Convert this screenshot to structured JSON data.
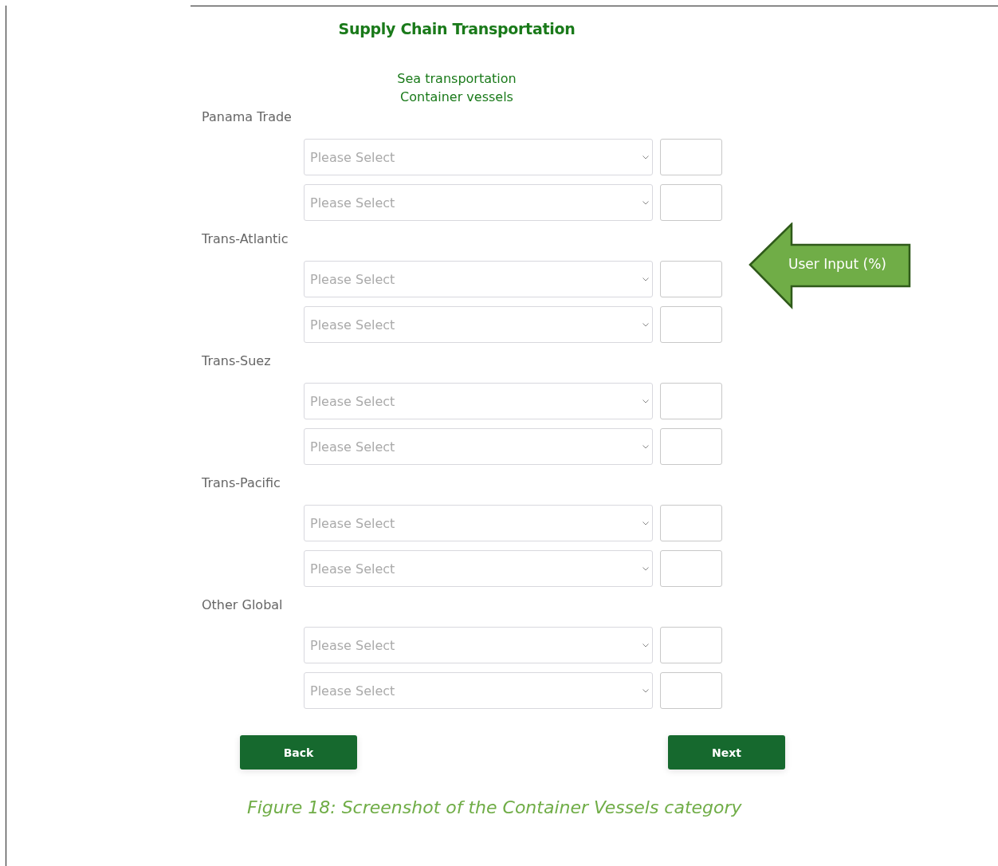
{
  "title": "Supply Chain Transportation",
  "subtitle": [
    "Sea transportation",
    "Container vessels"
  ],
  "sections": [
    {
      "label": "Panama Trade",
      "rows": [
        {
          "placeholder": "Please Select"
        },
        {
          "placeholder": "Please Select"
        }
      ]
    },
    {
      "label": "Trans-Atlantic",
      "rows": [
        {
          "placeholder": "Please Select"
        },
        {
          "placeholder": "Please Select"
        }
      ]
    },
    {
      "label": "Trans-Suez",
      "rows": [
        {
          "placeholder": "Please Select"
        },
        {
          "placeholder": "Please Select"
        }
      ]
    },
    {
      "label": "Trans-Pacific",
      "rows": [
        {
          "placeholder": "Please Select"
        },
        {
          "placeholder": "Please Select"
        }
      ]
    },
    {
      "label": "Other Global",
      "rows": [
        {
          "placeholder": "Please Select"
        },
        {
          "placeholder": "Please Select"
        }
      ]
    }
  ],
  "callout": "User Input (%)",
  "buttons": [
    {
      "label": "Back"
    },
    {
      "label": "Next"
    }
  ],
  "caption": "Figure 18: Screenshot of the Container Vessels category"
}
